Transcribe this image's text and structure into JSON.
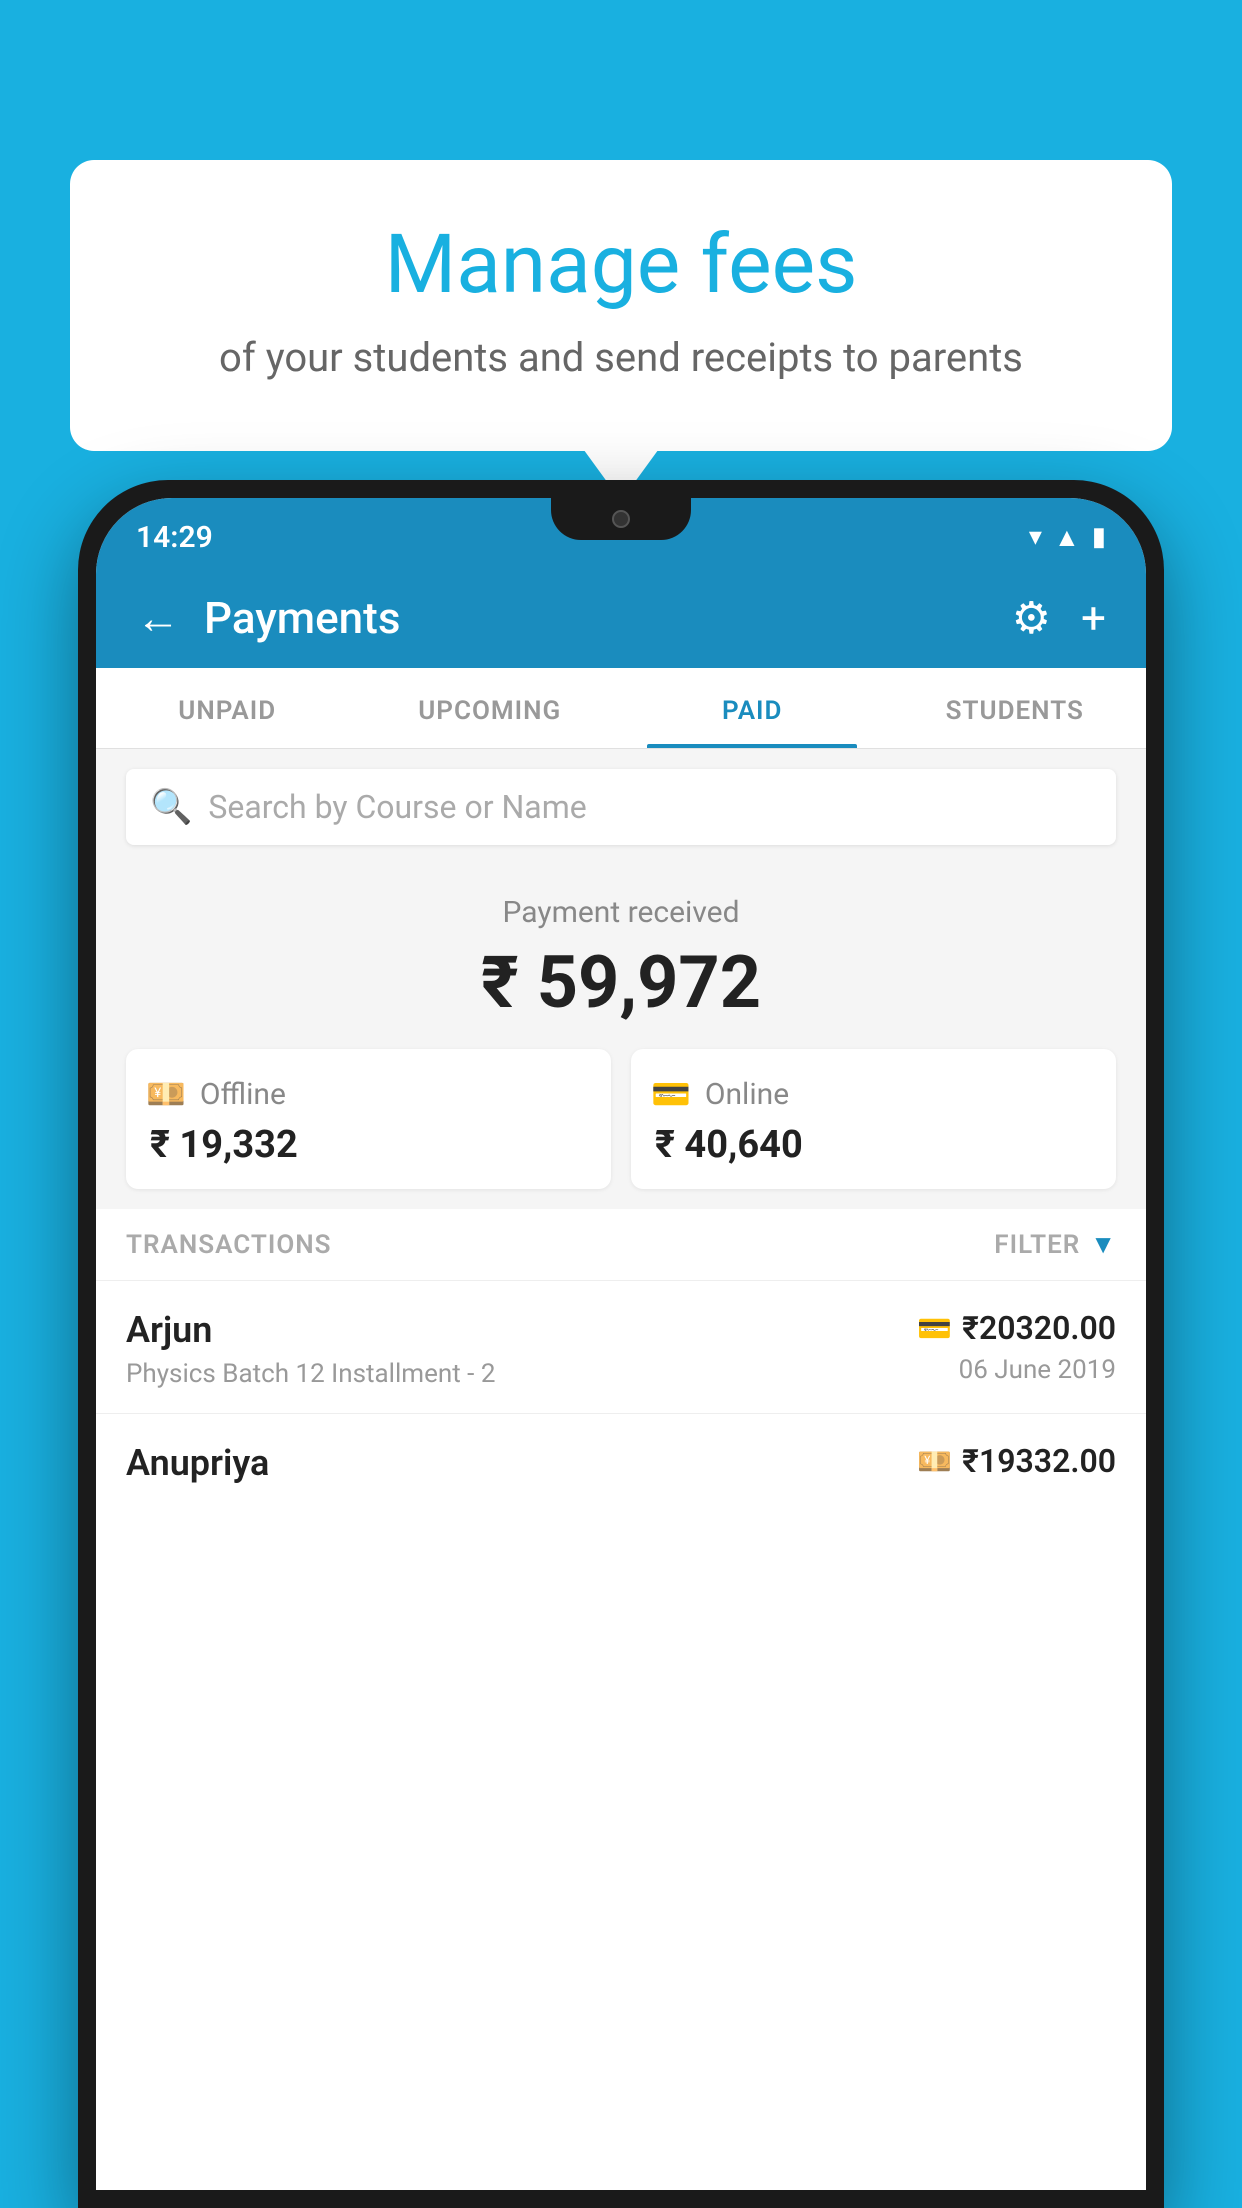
{
  "background_color": "#19B0E0",
  "bubble": {
    "title": "Manage fees",
    "subtitle": "of your students and send receipts to parents"
  },
  "status_bar": {
    "time": "14:29"
  },
  "header": {
    "title": "Payments",
    "back_label": "←",
    "gear_label": "⚙",
    "plus_label": "+"
  },
  "tabs": [
    {
      "label": "UNPAID",
      "active": false
    },
    {
      "label": "UPCOMING",
      "active": false
    },
    {
      "label": "PAID",
      "active": true
    },
    {
      "label": "STUDENTS",
      "active": false
    }
  ],
  "search": {
    "placeholder": "Search by Course or Name"
  },
  "payment_summary": {
    "label": "Payment received",
    "amount": "₹ 59,972",
    "offline": {
      "icon": "₹",
      "type": "Offline",
      "amount": "₹ 19,332"
    },
    "online": {
      "icon": "💳",
      "type": "Online",
      "amount": "₹ 40,640"
    }
  },
  "transactions_section": {
    "label": "TRANSACTIONS",
    "filter_label": "FILTER"
  },
  "transactions": [
    {
      "name": "Arjun",
      "description": "Physics Batch 12 Installment - 2",
      "amount": "₹20320.00",
      "date": "06 June 2019",
      "icon_type": "card"
    },
    {
      "name": "Anupriya",
      "description": "",
      "amount": "₹19332.00",
      "date": "",
      "icon_type": "cash"
    }
  ]
}
